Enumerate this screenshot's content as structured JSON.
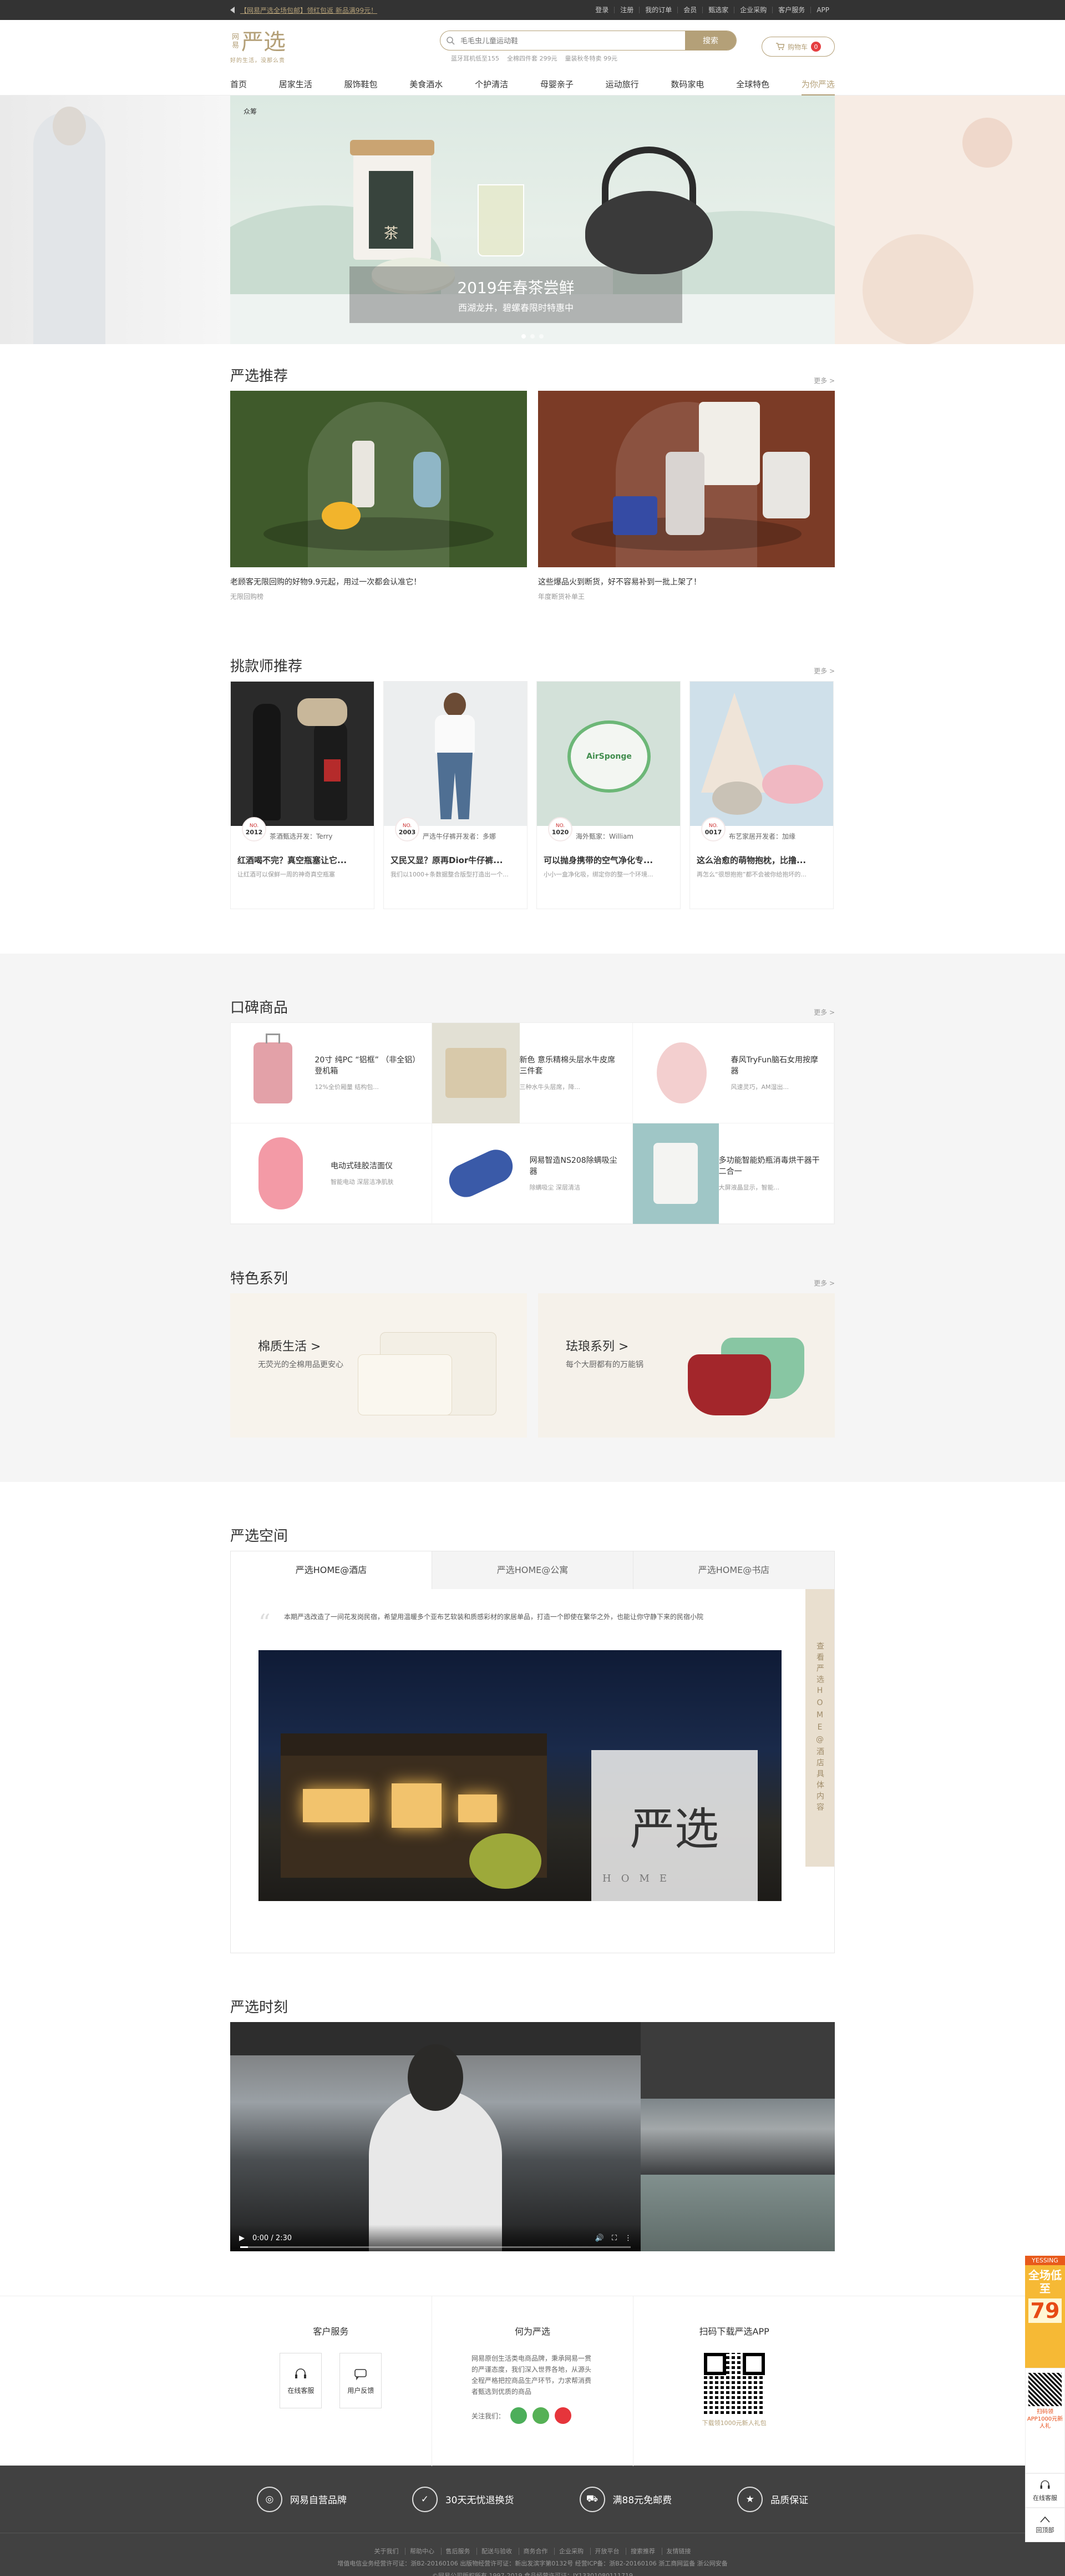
{
  "topbar": {
    "notice": "【网易严选全场包邮】领红包返 新品满99元！",
    "links": [
      "登录",
      "注册",
      "我的订单",
      "会员",
      "甄选家",
      "企业采购",
      "客户服务",
      "APP"
    ]
  },
  "logo": {
    "small": "网易",
    "big": "严选",
    "slogan": "好的生活，没那么贵"
  },
  "search": {
    "placeholder": "毛毛虫儿童运动鞋",
    "button": "搜索",
    "hotwords": [
      "蓝牙耳机低至155",
      "全棉四件套 299元",
      "童装秋冬特卖 99元"
    ]
  },
  "cart": {
    "label": "购物车",
    "count": "0"
  },
  "nav": [
    "首页",
    "居家生活",
    "服饰鞋包",
    "美食酒水",
    "个护清洁",
    "母婴亲子",
    "运动旅行",
    "数码家电",
    "全球特色",
    "为你严选"
  ],
  "hero": {
    "tag": "众筹",
    "jar_label": "茶",
    "title": "2019年春茶尝鲜",
    "subtitle": "西湖龙井，碧螺春限时特惠中"
  },
  "recommend": {
    "title": "严选推荐",
    "more": "更多 >",
    "items": [
      {
        "desc": "老顾客无限回购的好物9.9元起，用过一次都会认准它！",
        "sub": "无限回购榜"
      },
      {
        "desc": "这些爆品火到断货，好不容易补到一批上架了！",
        "sub": "年度断货补单王"
      }
    ]
  },
  "designers": {
    "title": "挑款师推荐",
    "more": "更多 >",
    "items": [
      {
        "no": "2012",
        "who": "茶酒甄选开发：Terry",
        "title": "红酒喝不完？真空瓶塞让它...",
        "desc": "让红酒可以保鲜一周的神奇真空瓶塞"
      },
      {
        "no": "2003",
        "who": "严选牛仔裤开发者：多娜",
        "title": "又民又显？原再Dior牛仔裤...",
        "desc": "我们以1000+条数据整合版型打造出一个..."
      },
      {
        "no": "1020",
        "who": "海外甄家：William",
        "title": "可以抛身携带的空气净化专...",
        "desc": "小小一盒净化吸，绑定你的整一个环境..."
      },
      {
        "no": "0017",
        "who": "布艺家居开发者：加缘",
        "title": "这么治愈的萌物抱枕，比撸...",
        "desc": "再怎么“很想抱抱”都不会被你给抱坏的..."
      }
    ]
  },
  "koubei": {
    "title": "口碑商品",
    "more": "更多 >",
    "items": [
      {
        "name": "20寸 纯PC “铝框” （非全铝）登机箱",
        "sub": "12%全价厢量 结构包..."
      },
      {
        "name": "新色 意乐精棉头层水牛皮席三件套",
        "sub": "三种水牛头层席，降..."
      },
      {
        "name": "春风TryFun脑石女用按摩器",
        "sub": "风速灵巧，AM湿出..."
      },
      {
        "name": "电动式硅胶洁面仪",
        "sub": "智能电动 深层洁净肌肤"
      },
      {
        "name": "网易智造NS208除螨吸尘器",
        "sub": "除螨吸尘 深层清洁"
      },
      {
        "name": "多功能智能奶瓶消毒烘干器干二合一",
        "sub": "大屏液晶显示，智能..."
      }
    ]
  },
  "special": {
    "title": "特色系列",
    "more": "更多 >",
    "items": [
      {
        "name": "棉质生活 >",
        "sub": "无荧光的全棉用品更安心"
      },
      {
        "name": "珐琅系列 >",
        "sub": "每个大厨都有的万能锅"
      }
    ]
  },
  "space": {
    "title": "严选空间",
    "tabs": [
      "严选HOME@酒店",
      "严选HOME@公寓",
      "严选HOME@书店"
    ],
    "text": "本期严选改造了一间花发岗民宿，希望用温暖多个亚布艺软装和质感彩材的家居单品，打造一个即使在繁华之外，也能让你守静下来的民宿小院",
    "sign": "严选",
    "sign_sub": "HOME",
    "rail": "查看严选HOME@酒店具体内容"
  },
  "moment": {
    "title": "严选时刻",
    "time": "0:00 / 2:30"
  },
  "service": {
    "cs_title": "客户服务",
    "cs_items": [
      "在线客服",
      "用户反馈"
    ],
    "about_title": "何为严选",
    "about_text": "网易原创生活类电商品牌，秉承网易一贯的严谨态度，我们深入世界各地，从源头全程严格把控商品生产环节，力求帮消费者甄选到优质的商品",
    "follow": "关注我们：",
    "app_title": "扫码下载严选APP",
    "app_sub": "下载领1000元新人礼包"
  },
  "footer": {
    "features": [
      "网易自营品牌",
      "30天无忧退换货",
      "满88元免邮费",
      "品质保证"
    ],
    "links": [
      "关于我们",
      "帮助中心",
      "售后服务",
      "配送与验收",
      "商务合作",
      "企业采购",
      "开放平台",
      "搜索推荐",
      "友情链接"
    ],
    "legal1": "增值电信业务经营许可证：浙B2-20160106  出版物经营许可证：新出发滨字第0132号  经营ICP备：浙B2-20160106  浙工商网监备 浙公网安备",
    "legal2": "©网易公司版权所有 1997-2019  食品经营许可证：JY13301080111719"
  },
  "side": {
    "promo_a": "YESSING",
    "promo_b": "全场低至",
    "promo_c": "79",
    "app_txt": "扫码领APP1000元新人礼",
    "btn1": "在线客服",
    "btn2": "回顶部"
  }
}
